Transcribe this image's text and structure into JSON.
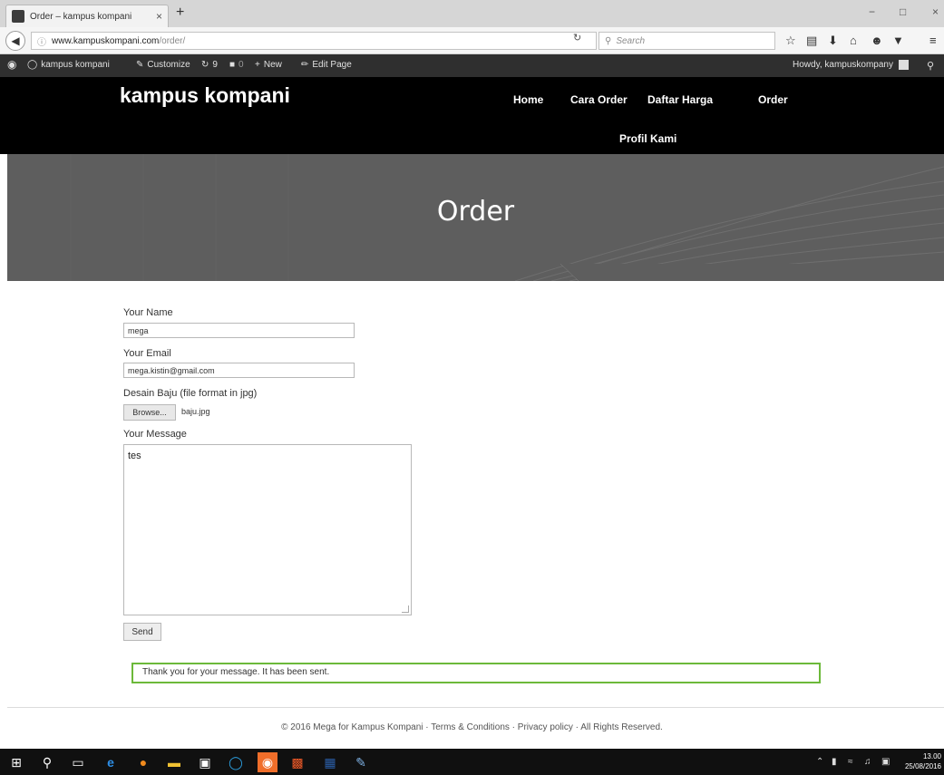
{
  "browser": {
    "tab_title": "Order – kampus kompani",
    "url_host": "www.kampuskompani.com",
    "url_path": "/order/",
    "search_placeholder": "Search",
    "new_tab": "+",
    "close_tab": "×",
    "minimize": "−",
    "restore": "□",
    "close_window": "×"
  },
  "adminbar": {
    "site_name": "kampus kompani",
    "customize": "Customize",
    "updates": "9",
    "comments": "0",
    "new": "New",
    "edit_page": "Edit Page",
    "howdy": "Howdy, kampuskompany"
  },
  "site": {
    "title": "kampus kompani",
    "menu": [
      "Home",
      "Cara Order",
      "Daftar Harga",
      "Order",
      "Profil Kami"
    ]
  },
  "page": {
    "title": "Order"
  },
  "form": {
    "name_label": "Your Name",
    "name_value": "mega",
    "email_label": "Your Email",
    "email_value": "mega.kistin@gmail.com",
    "file_label": "Desain Baju (file format in jpg)",
    "browse_label": "Browse...",
    "file_name": "baju.jpg",
    "message_label": "Your Message",
    "message_value": "tes",
    "send_label": "Send",
    "response": "Thank you for your message. It has been sent."
  },
  "footer": {
    "text": "© 2016 Mega for Kampus Kompani · Terms & Conditions · Privacy policy · All Rights Reserved."
  },
  "taskbar": {
    "time": "13.00",
    "date": "25/08/2016"
  }
}
